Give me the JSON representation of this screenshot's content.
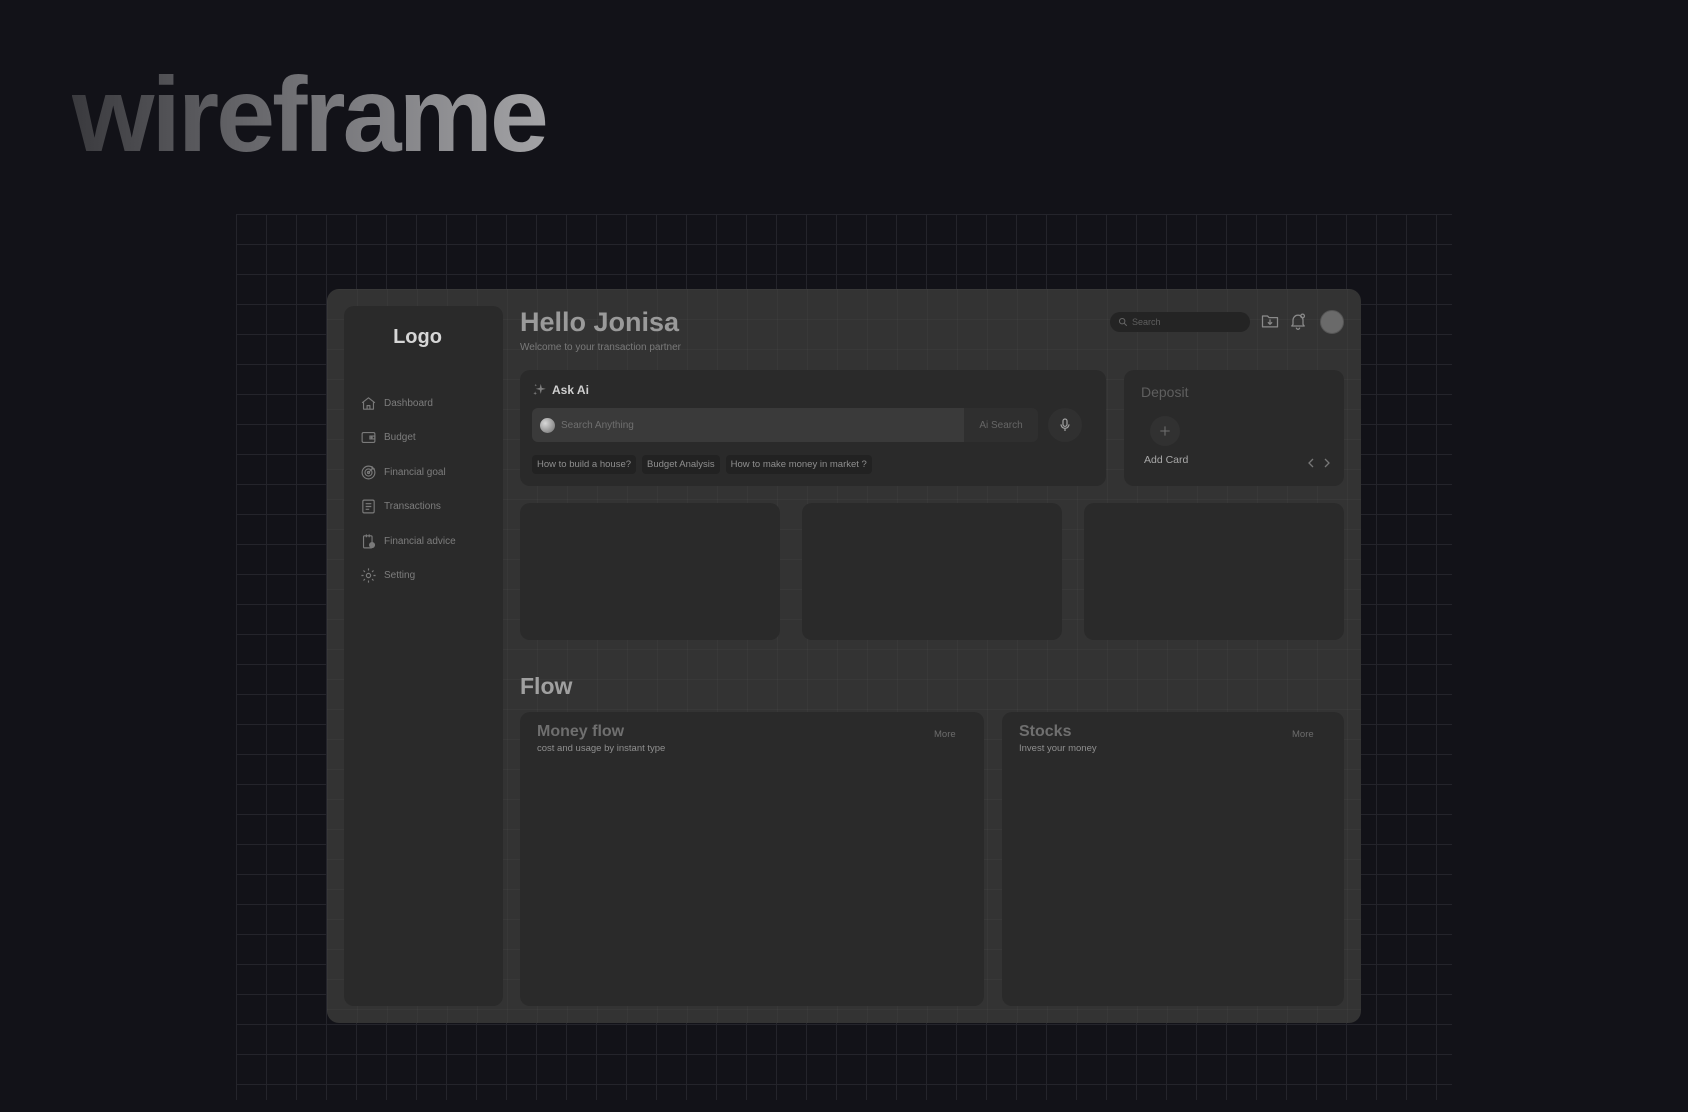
{
  "hero": {
    "title": "wireframe"
  },
  "sidebar": {
    "logo": "Logo",
    "items": [
      {
        "label": "Dashboard",
        "icon": "home-icon"
      },
      {
        "label": "Budget",
        "icon": "wallet-icon"
      },
      {
        "label": "Financial goal",
        "icon": "target-icon"
      },
      {
        "label": "Transactions",
        "icon": "document-icon"
      },
      {
        "label": "Financial advice",
        "icon": "advice-icon"
      },
      {
        "label": "Setting",
        "icon": "gear-icon"
      }
    ]
  },
  "header": {
    "greeting": "Hello Jonisa",
    "subtitle": "Welcome to your transaction partner",
    "search_placeholder": "Search"
  },
  "ask_ai": {
    "title": "Ask Ai",
    "placeholder": "Search Anything",
    "button": "Ai Search",
    "suggestions": [
      "How to build a house?",
      "Budget Analysis",
      "How to make money in market ?"
    ]
  },
  "deposit": {
    "title": "Deposit",
    "add_label": "Add Card"
  },
  "flow": {
    "title": "Flow",
    "money_flow": {
      "title": "Money flow",
      "subtitle": "cost and usage by instant type",
      "more": "More"
    },
    "stocks": {
      "title": "Stocks",
      "subtitle": "Invest your money",
      "more": "More"
    }
  },
  "colors": {
    "page_bg": "#121218",
    "frame_bg": "#333333",
    "card_bg": "#2a2a2a",
    "muted_text": "#7d7d7d"
  }
}
